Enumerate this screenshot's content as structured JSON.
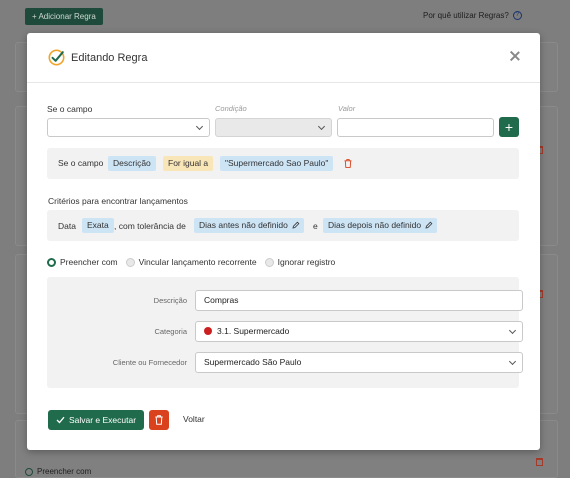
{
  "background": {
    "add_rule_label": "+ Adicionar Regra",
    "why_use_rules": "Por quê utilizar Regras?",
    "help_icon_glyph": "?",
    "bottom_label": "Preencher com"
  },
  "modal": {
    "title": "Editando Regra",
    "fields_header": {
      "field_label": "Se o campo",
      "condition_label": "Condição",
      "value_label": "Valor",
      "field_value": "",
      "condition_value": "",
      "value_value": ""
    },
    "add_button_glyph": "+",
    "condition_row": {
      "prefix": "Se o campo",
      "field_tag": "Descrição",
      "operator_tag": "For igual a",
      "value_tag": "\"Supermercado Sao Paulo\""
    },
    "criteria": {
      "title": "Critérios para encontrar lançamentos",
      "date_label": "Data",
      "exact_tag": "Exata",
      "tolerance_text": ", com tolerância de",
      "days_before_tag": "Dias antes não definido",
      "and_text": "e",
      "days_after_tag": "Dias depois não definido"
    },
    "actions": {
      "options": [
        "Preencher com",
        "Vincular lançamento recorrente",
        "Ignorar registro"
      ],
      "selected": "Preencher com"
    },
    "form": {
      "description_label": "Descrição",
      "description_value": "Compras",
      "category_label": "Categoria",
      "category_value": "3.1. Supermercado",
      "category_color": "#cc2020",
      "client_label": "Cliente ou Fornecedor",
      "client_value": "Supermercado São Paulo"
    },
    "save_button": "Salvar e Executar",
    "back_link": "Voltar"
  },
  "colors": {
    "primary_green": "#1f6b4c",
    "danger_red": "#d9421c",
    "tag_blue": "#cde4f5",
    "tag_yellow": "#f8e5b8"
  }
}
